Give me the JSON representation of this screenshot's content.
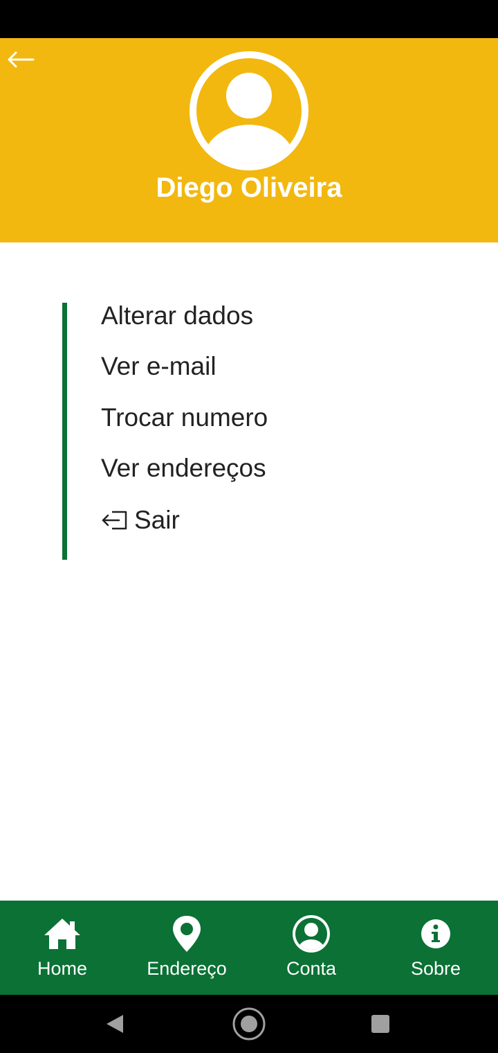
{
  "header": {
    "back_icon": "arrow-left-icon",
    "avatar_icon": "user-circle-icon",
    "user_name": "Diego Oliveira",
    "background_color": "#F2B80F"
  },
  "menu": {
    "accent_color": "#0B7135",
    "items": [
      {
        "label": "Alterar dados"
      },
      {
        "label": "Ver e-mail"
      },
      {
        "label": "Trocar numero"
      },
      {
        "label": "Ver endereços"
      },
      {
        "label": "Sair",
        "icon": "logout-icon"
      }
    ]
  },
  "bottom_nav": {
    "background_color": "#0B7135",
    "items": [
      {
        "label": "Home",
        "icon": "home-icon"
      },
      {
        "label": "Endereço",
        "icon": "map-pin-icon"
      },
      {
        "label": "Conta",
        "icon": "user-icon"
      },
      {
        "label": "Sobre",
        "icon": "info-icon"
      }
    ]
  },
  "system_nav": {
    "buttons": [
      "back-triangle-icon",
      "home-circle-icon",
      "recents-square-icon"
    ]
  }
}
